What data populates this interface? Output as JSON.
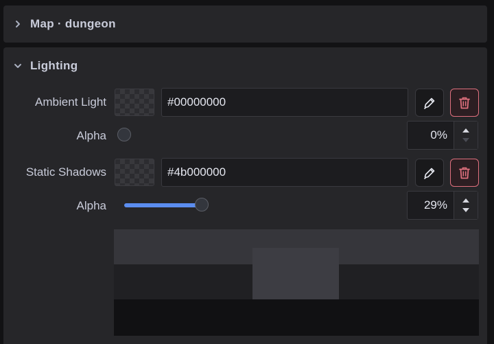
{
  "panels": {
    "map": {
      "title": "Map · dungeon",
      "expanded": false,
      "chevron_icon": "chevron-right-icon"
    },
    "lighting": {
      "title": "Lighting",
      "expanded": true,
      "chevron_icon": "chevron-down-icon",
      "ambient": {
        "label": "Ambient Light",
        "color_value": "#00000000",
        "swatch_color": "#000000",
        "picker_icon": "eyedropper-icon",
        "delete_icon": "trash-icon",
        "alpha_label": "Alpha",
        "alpha_percent": 0,
        "alpha_text": "0%"
      },
      "shadows": {
        "label": "Static Shadows",
        "color_value": "#4b000000",
        "swatch_color": "#4b0000",
        "picker_icon": "eyedropper-icon",
        "delete_icon": "trash-icon",
        "alpha_label": "Alpha",
        "alpha_percent": 29,
        "alpha_text": "29%"
      }
    }
  },
  "colors": {
    "accent": "#5b8def",
    "danger": "#e0707e",
    "panel_bg": "#262629"
  }
}
